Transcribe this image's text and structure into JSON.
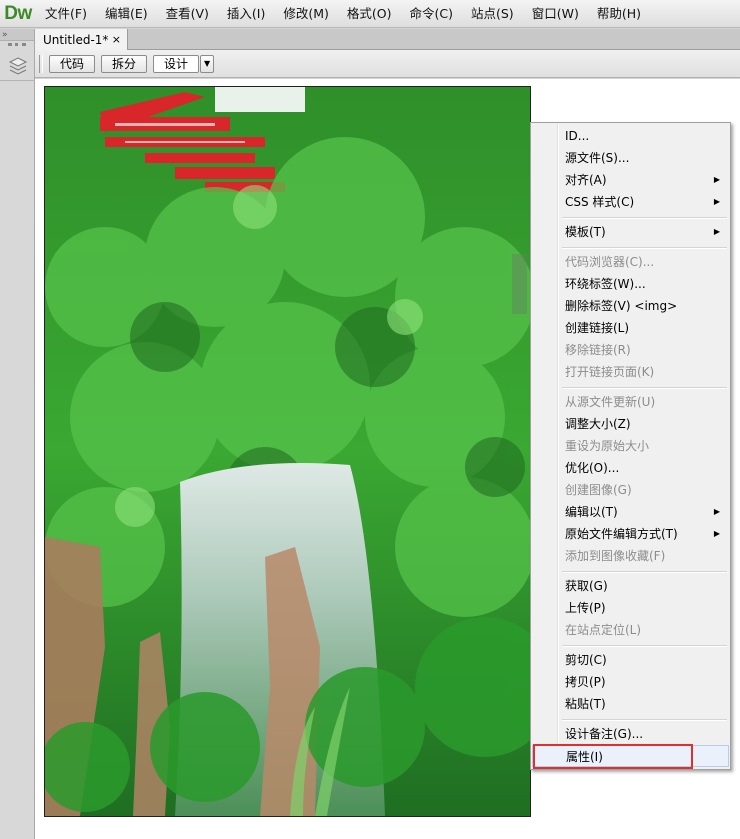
{
  "app": {
    "logo": "Dw"
  },
  "menubar": [
    "文件(F)",
    "编辑(E)",
    "查看(V)",
    "插入(I)",
    "修改(M)",
    "格式(O)",
    "命令(C)",
    "站点(S)",
    "窗口(W)",
    "帮助(H)"
  ],
  "left_panel": {
    "collapse_label": "»"
  },
  "document": {
    "tab_title": "Untitled-1*",
    "close_glyph": "×"
  },
  "toolbar": {
    "code": "代码",
    "split": "拆分",
    "design": "设计",
    "dropdown_glyph": "▼"
  },
  "context_menu": {
    "items": [
      {
        "label": "ID...",
        "enabled": true
      },
      {
        "label": "源文件(S)...",
        "enabled": true
      },
      {
        "label": "对齐(A)",
        "enabled": true,
        "submenu": true
      },
      {
        "label": "CSS 样式(C)",
        "enabled": true,
        "submenu": true
      },
      {
        "label": "模板(T)",
        "enabled": true,
        "submenu": true
      },
      {
        "label": "代码浏览器(C)...",
        "enabled": false
      },
      {
        "label": "环绕标签(W)...",
        "enabled": true
      },
      {
        "label": "删除标签(V) <img>",
        "enabled": true
      },
      {
        "label": "创建链接(L)",
        "enabled": true
      },
      {
        "label": "移除链接(R)",
        "enabled": false
      },
      {
        "label": "打开链接页面(K)",
        "enabled": false
      },
      {
        "label": "从源文件更新(U)",
        "enabled": false
      },
      {
        "label": "调整大小(Z)",
        "enabled": true
      },
      {
        "label": "重设为原始大小",
        "enabled": false
      },
      {
        "label": "优化(O)...",
        "enabled": true
      },
      {
        "label": "创建图像(G)",
        "enabled": false
      },
      {
        "label": "编辑以(T)",
        "enabled": true,
        "submenu": true
      },
      {
        "label": "原始文件编辑方式(T)",
        "enabled": true,
        "submenu": true
      },
      {
        "label": "添加到图像收藏(F)",
        "enabled": false
      },
      {
        "label": "获取(G)",
        "enabled": true
      },
      {
        "label": "上传(P)",
        "enabled": true
      },
      {
        "label": "在站点定位(L)",
        "enabled": false
      },
      {
        "label": "剪切(C)",
        "enabled": true
      },
      {
        "label": "拷贝(P)",
        "enabled": true
      },
      {
        "label": "粘贴(T)",
        "enabled": true
      },
      {
        "label": "设计备注(G)...",
        "enabled": true
      },
      {
        "label": "属性(I)",
        "enabled": true,
        "highlighted": true
      }
    ]
  },
  "colors": {
    "logo_green": "#3d8a2a",
    "highlight_box": "#e0302c",
    "disabled_text": "#8c8c8c"
  }
}
